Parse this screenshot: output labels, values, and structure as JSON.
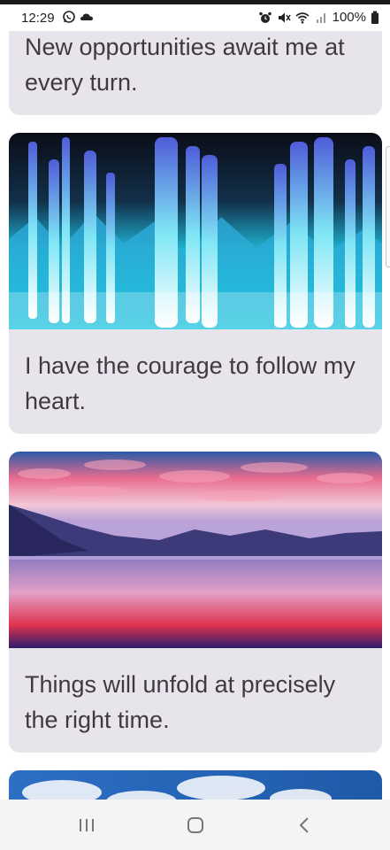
{
  "status_bar": {
    "time": "12:29",
    "battery": "100%",
    "left_icons": [
      "whatsapp-icon",
      "cloud-icon"
    ],
    "right_icons": [
      "alarm-icon",
      "mute-icon",
      "wifi-icon",
      "signal-icon",
      "battery-icon"
    ]
  },
  "cards": [
    {
      "quote": "New opportunities await me at every turn.",
      "image": null
    },
    {
      "quote": "I have the courage to follow my heart.",
      "image": "blue-glowing-fibers"
    },
    {
      "quote": "Things will unfold at precisely the right time.",
      "image": "lake-sunset-mountains"
    },
    {
      "quote": "",
      "image": "blue-sky-clouds"
    }
  ],
  "nav_bar": {
    "buttons": [
      "recent-apps",
      "home",
      "back"
    ]
  },
  "colors": {
    "card_background": "#e8e4ec",
    "quote_text": "#3f3a42",
    "page_background": "#ffffff"
  }
}
